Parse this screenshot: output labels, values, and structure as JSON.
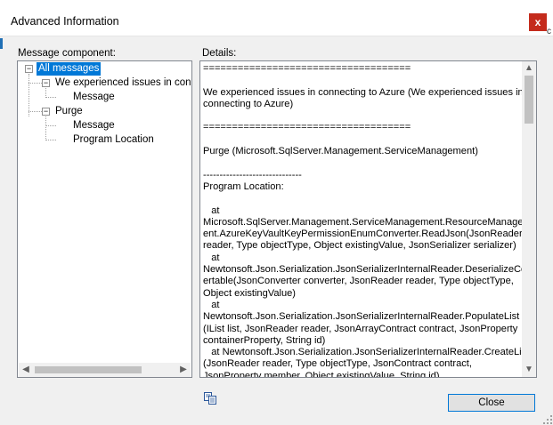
{
  "window": {
    "title": "Advanced Information",
    "close_glyph": "x"
  },
  "message_component": {
    "label": "Message component:",
    "tree": {
      "root": "All messages",
      "nodes": [
        {
          "label": "We experienced issues in connecting to Azure",
          "children": [
            "Message"
          ]
        },
        {
          "label": "Purge",
          "children": [
            "Message",
            "Program Location"
          ]
        }
      ]
    }
  },
  "details": {
    "label": "Details:",
    "lines": [
      "====================================",
      "",
      "We experienced issues in connecting to Azure (We experienced issues in",
      "connecting to Azure)",
      "",
      "====================================",
      "",
      "Purge (Microsoft.SqlServer.Management.ServiceManagement)",
      "",
      "------------------------------",
      "Program Location:",
      "",
      "   at",
      "Microsoft.SqlServer.Management.ServiceManagement.ResourceManagem",
      "ent.AzureKeyVaultKeyPermissionEnumConverter.ReadJson(JsonReader",
      "reader, Type objectType, Object existingValue, JsonSerializer serializer)",
      "   at",
      "Newtonsoft.Json.Serialization.JsonSerializerInternalReader.DeserializeConv",
      "ertable(JsonConverter converter, JsonReader reader, Type objectType,",
      "Object existingValue)",
      "   at",
      "Newtonsoft.Json.Serialization.JsonSerializerInternalReader.PopulateList",
      "(IList list, JsonReader reader, JsonArrayContract contract, JsonProperty",
      "containerProperty, String id)",
      "   at Newtonsoft.Json.Serialization.JsonSerializerInternalReader.CreateList",
      "(JsonReader reader, Type objectType, JsonContract contract,",
      "JsonProperty member, Object existingValue, String id)"
    ]
  },
  "buttons": {
    "close_label": "Close"
  },
  "icons": {
    "copy": "copy-icon",
    "close": "close-icon"
  },
  "colors": {
    "selection": "#0078d7",
    "close_bg": "#c42b1c",
    "button_border": "#0078d7"
  }
}
